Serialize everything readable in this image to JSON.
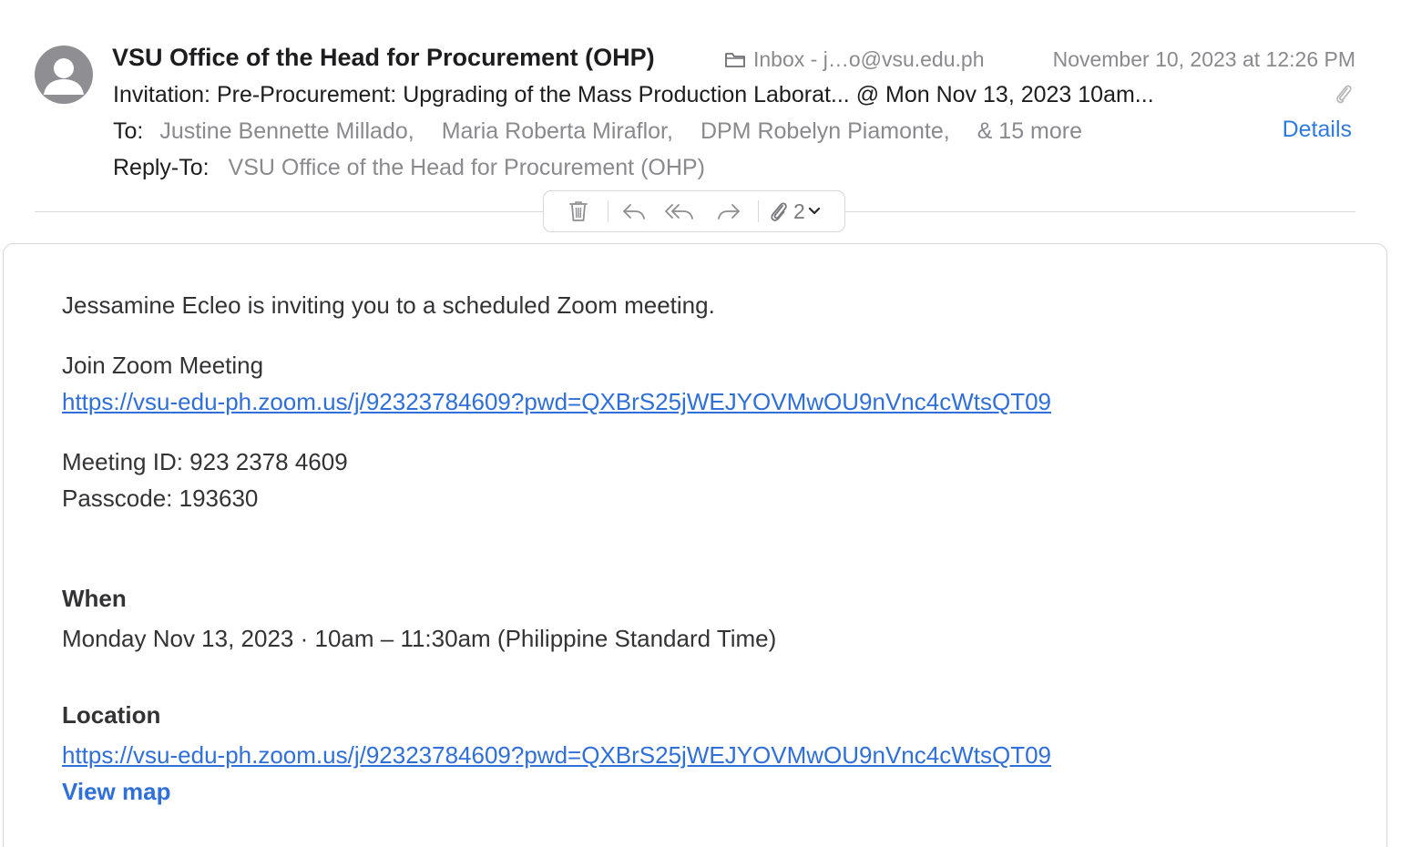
{
  "header": {
    "sender": "VSU Office of the Head for Procurement (OHP)",
    "mailbox": "Inbox - j…o@vsu.edu.ph",
    "datetime": "November 10, 2023 at 12:26 PM",
    "subject": "Invitation: Pre-Procurement: Upgrading of the Mass Production Laborat... @ Mon Nov 13, 2023 10am...",
    "to_label": "To:",
    "recipients": [
      "Justine Bennette Millado,",
      "Maria Roberta Miraflor,",
      "DPM Robelyn Piamonte,"
    ],
    "more_recipients": "& 15 more",
    "details_link": "Details",
    "reply_to_label": "Reply-To:",
    "reply_to_value": "VSU Office of the Head for Procurement (OHP)"
  },
  "toolbar": {
    "attachment_count": "2",
    "icons": [
      "trash-icon",
      "reply-icon",
      "reply-all-icon",
      "forward-icon",
      "paperclip-icon",
      "chevron-down-icon"
    ]
  },
  "body": {
    "intro": "Jessamine Ecleo is inviting you to a scheduled Zoom meeting.",
    "join_label": "Join Zoom Meeting",
    "join_url": "https://vsu-edu-ph.zoom.us/j/92323784609?pwd=QXBrS25jWEJYOVMwOU9nVnc4cWtsQT09",
    "meeting_id": "Meeting ID: 923 2378 4609",
    "passcode": "Passcode: 193630",
    "when_heading": "When",
    "when_value": "Monday Nov 13, 2023 · 10am – 11:30am (Philippine Standard Time)",
    "location_heading": "Location",
    "location_url": "https://vsu-edu-ph.zoom.us/j/92323784609?pwd=QXBrS25jWEJYOVMwOU9nVnc4cWtsQT09",
    "view_map": "View map"
  },
  "colors": {
    "link": "#2f6fd9",
    "details": "#2f7bdc",
    "muted": "#8a8a8e",
    "avatar": "#8e8e93"
  }
}
